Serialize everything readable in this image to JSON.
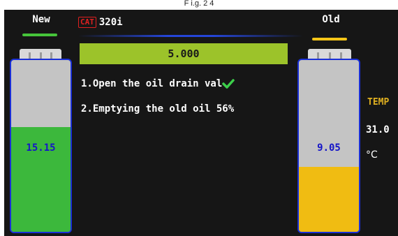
{
  "caption": "F i.g. 2 4",
  "header": {
    "brand_badge": "CAT",
    "model": "320i"
  },
  "new_tank": {
    "label": "New",
    "value": "15.15",
    "fill_fraction": 0.61,
    "fill_color": "#3cb83c",
    "indicator_color": "#46c43a"
  },
  "old_tank": {
    "label": "Old",
    "value": "9.05",
    "fill_fraction": 0.38,
    "fill_color": "#f0bc12",
    "indicator_color": "#f5c518"
  },
  "progress": {
    "value": "5.000",
    "color": "#9cc32a"
  },
  "steps": [
    {
      "text": "1.Open the oil drain val",
      "status_icon": "check-icon"
    },
    {
      "text": "2.Emptying the old oil 56%"
    }
  ],
  "temperature": {
    "label": "TEMP",
    "value": "31.0",
    "unit": "°C"
  }
}
